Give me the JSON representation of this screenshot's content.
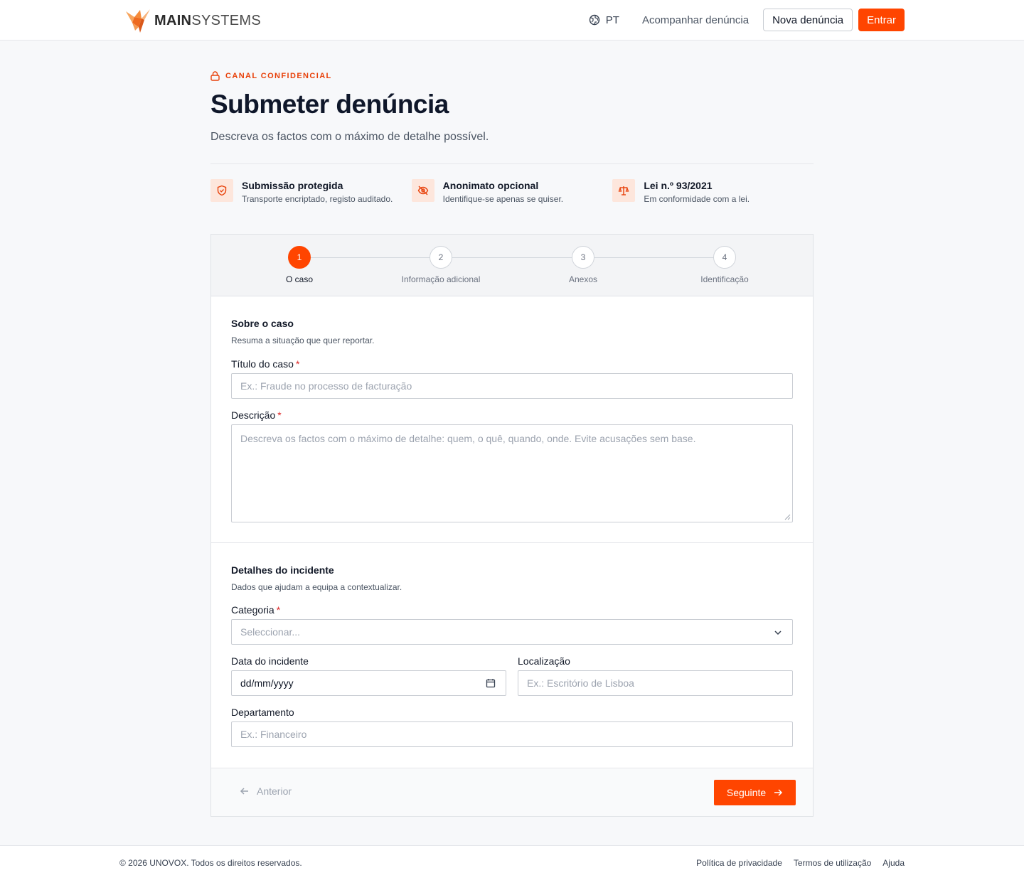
{
  "header": {
    "logo": {
      "main": "MAIN",
      "systems": "SYSTEMS"
    },
    "language": "PT",
    "track_link": "Acompanhar denúncia",
    "new_report_button": "Nova denúncia",
    "login_button": "Entrar",
    "brand_color": "#ff4500"
  },
  "intro": {
    "eyebrow": "CANAL CONFIDENCIAL",
    "title": "Submeter denúncia",
    "subtitle": "Descreva os factos com o máximo de detalhe possível."
  },
  "features": [
    {
      "icon": "shield-check-icon",
      "title": "Submissão protegida",
      "desc": "Transporte encriptado, registo auditado."
    },
    {
      "icon": "eye-off-icon",
      "title": "Anonimato opcional",
      "desc": "Identifique-se apenas se quiser."
    },
    {
      "icon": "scale-icon",
      "title": "Lei n.º 93/2021",
      "desc": "Em conformidade com a lei."
    }
  ],
  "stepper": {
    "current": 1,
    "steps": [
      {
        "number": "1",
        "label": "O caso"
      },
      {
        "number": "2",
        "label": "Informação adicional"
      },
      {
        "number": "3",
        "label": "Anexos"
      },
      {
        "number": "4",
        "label": "Identificação"
      }
    ]
  },
  "case_section": {
    "title": "Sobre o caso",
    "description": "Resuma a situação que quer reportar.",
    "case_title_label": "Título do caso",
    "case_title_placeholder": "Ex.: Fraude no processo de facturação",
    "case_title_value": "",
    "description_label": "Descrição",
    "description_placeholder": "Descreva os factos com o máximo de detalhe: quem, o quê, quando, onde. Evite acusações sem base.",
    "description_value": "",
    "required_mark": "*"
  },
  "incident_section": {
    "title": "Detalhes do incidente",
    "description": "Dados que ajudam a equipa a contextualizar.",
    "category_label": "Categoria",
    "category_placeholder": "Seleccionar...",
    "date_label": "Data do incidente",
    "date_value": "dd/mm/yyyy",
    "location_label": "Localização",
    "location_placeholder": "Ex.: Escritório de Lisboa",
    "department_label": "Departamento",
    "department_placeholder": "Ex.: Financeiro"
  },
  "actions": {
    "previous": "Anterior",
    "next": "Seguinte"
  },
  "footer": {
    "copyright": "© 2026 UNOVOX. Todos os direitos reservados.",
    "links": [
      "Política de privacidade",
      "Termos de utilização",
      "Ajuda"
    ]
  }
}
